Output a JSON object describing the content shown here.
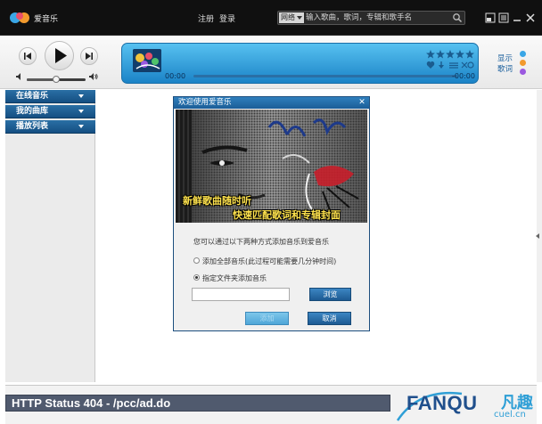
{
  "app": {
    "name": "爱音乐"
  },
  "auth": {
    "register": "注册",
    "login": "登录"
  },
  "search": {
    "scope": "网络",
    "placeholder": "输入歌曲，歌词，专辑和歌手名"
  },
  "player": {
    "time_elapsed": "00:00",
    "time_remaining": "-00:00",
    "volume": 0.5,
    "progress": 0
  },
  "side_links": {
    "show": "显示",
    "lyrics": "歌词"
  },
  "sidebar": {
    "items": [
      {
        "label": "在线音乐"
      },
      {
        "label": "我的曲库"
      },
      {
        "label": "播放列表"
      }
    ]
  },
  "dialog": {
    "title": "欢迎使用爱音乐",
    "banner_line1": "新鲜歌曲随时听",
    "banner_line2": "快速匹配歌词和专辑封面",
    "intro": "您可以通过以下两种方式添加音乐到爱音乐",
    "option_all": "添加全部音乐(此过程可能需要几分钟时间)",
    "option_folder": "指定文件夹添加音乐",
    "folder_value": "",
    "browse": "浏览",
    "add": "添加",
    "cancel": "取消"
  },
  "status": {
    "message": "HTTP Status 404 - /pcc/ad.do"
  },
  "watermark": {
    "brand": "FANQU",
    "cn": "凡趣",
    "domain": "cuel.cn"
  },
  "colors": {
    "accent": "#1b83c7",
    "sidebar_nav": "#1e5f95",
    "titlebar": "#101010",
    "status_box": "#505a6e"
  }
}
